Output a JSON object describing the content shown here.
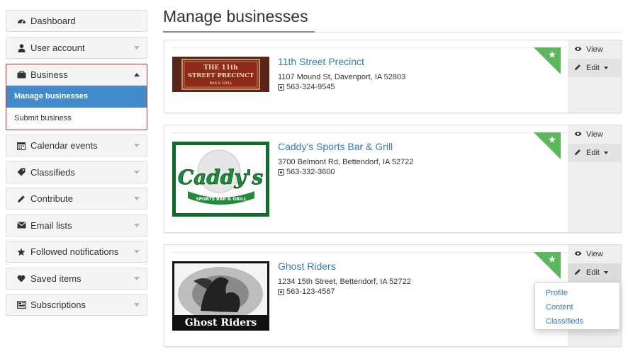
{
  "sidebar": {
    "dashboard": {
      "label": "Dashboard",
      "icon": "dashboard-icon"
    },
    "user_account": {
      "label": "User account",
      "icon": "user-icon"
    },
    "business": {
      "label": "Business",
      "icon": "briefcase-icon",
      "children": [
        {
          "label": "Manage businesses",
          "active": true
        },
        {
          "label": "Submit business",
          "active": false
        }
      ]
    },
    "items": [
      {
        "label": "Calendar events",
        "icon": "calendar-icon"
      },
      {
        "label": "Classifieds",
        "icon": "tag-icon"
      },
      {
        "label": "Contribute",
        "icon": "pencil-icon"
      },
      {
        "label": "Email lists",
        "icon": "envelope-icon"
      },
      {
        "label": "Followed notifications",
        "icon": "star-icon"
      },
      {
        "label": "Saved items",
        "icon": "heart-icon"
      },
      {
        "label": "Subscriptions",
        "icon": "newspaper-icon"
      }
    ]
  },
  "main": {
    "title": "Manage businesses",
    "businesses": [
      {
        "name": "11th Street Precinct",
        "address": "1107 Mound St, Davenport, IA 52803",
        "phone": "563-324-9545",
        "logo_lines": [
          "THE 11th",
          "STREET PRECINCT",
          "BAR & GRILL"
        ]
      },
      {
        "name": "Caddy's Sports Bar & Grill",
        "address": "3700 Belmont Rd, Bettendorf, IA 52722",
        "phone": "563-332-3600",
        "logo_lines": [
          "Caddy's",
          "SPORTS BAR & GRILL"
        ]
      },
      {
        "name": "Ghost Riders",
        "address": "1234 15th Street, Bettendorf, IA 52722",
        "phone": "563-123-4567",
        "logo_lines": [
          "Ghost Riders"
        ]
      }
    ],
    "actions": {
      "view": "View",
      "edit": "Edit"
    },
    "edit_menu": [
      "Profile",
      "Content",
      "Classifieds"
    ]
  },
  "colors": {
    "accent": "#428bca",
    "link": "#337ab7",
    "featured": "#5cb85c",
    "active_border": "#c9302c"
  }
}
